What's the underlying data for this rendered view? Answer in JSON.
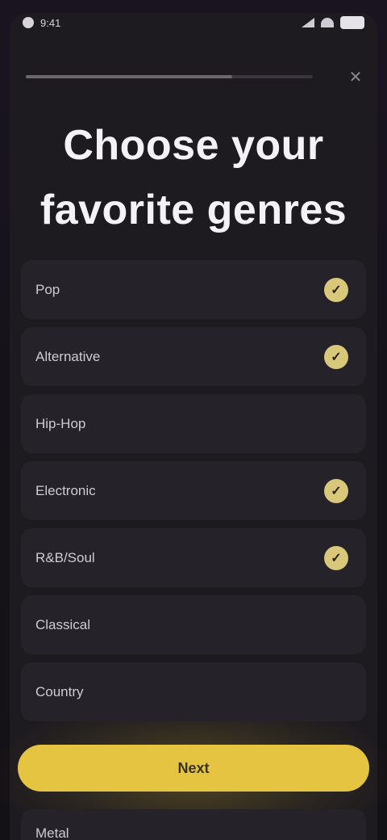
{
  "status_bar": {
    "time": "9:41",
    "battery": ""
  },
  "progress": {
    "fraction": 0.72
  },
  "close_icon": "close-icon",
  "title": "Choose your favorite genres",
  "options": [
    {
      "label": "Pop",
      "selected": true
    },
    {
      "label": "Alternative",
      "selected": true
    },
    {
      "label": "Hip-Hop",
      "selected": false
    },
    {
      "label": "Electronic",
      "selected": true
    },
    {
      "label": "R&B/Soul",
      "selected": true
    },
    {
      "label": "Classical",
      "selected": false
    },
    {
      "label": "Country",
      "selected": false
    }
  ],
  "continue_label": "Next",
  "bottom_option": {
    "label": "Metal"
  },
  "colors": {
    "accent": "#e4c440",
    "check": "#d9c77a",
    "background": "#151218",
    "card": "#25222a"
  }
}
